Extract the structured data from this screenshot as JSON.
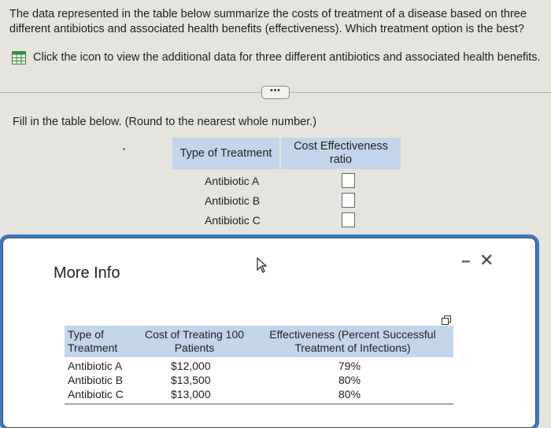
{
  "question": "The data represented in the table below summarize the costs of treatment of a disease based on three different antibiotics and associated health benefits (effectiveness). Which treatment option is the best?",
  "info_link": "Click the icon to view the additional data for three different antibiotics and associated health benefits.",
  "ellipsis": "•••",
  "instruction": "Fill in the table below. (Round to the nearest whole number.)",
  "answer_table": {
    "col1": "Type of Treatment",
    "col2_line1": "Cost Effectiveness",
    "col2_line2": "ratio",
    "rows": [
      "Antibiotic A",
      "Antibiotic B",
      "Antibiotic C"
    ]
  },
  "modal": {
    "title": "More Info",
    "minimize": "−",
    "close": "✕",
    "table": {
      "h1_line1": "Type of",
      "h1_line2": "Treatment",
      "h2_line1": "Cost of Treating 100",
      "h2_line2": "Patients",
      "h3_line1": "Effectiveness (Percent Successful",
      "h3_line2": "Treatment of Infections)",
      "rows": [
        {
          "type": "Antibiotic A",
          "cost": "$12,000",
          "eff": "79%"
        },
        {
          "type": "Antibiotic B",
          "cost": "$13,500",
          "eff": "80%"
        },
        {
          "type": "Antibiotic C",
          "cost": "$13,000",
          "eff": "80%"
        }
      ]
    }
  },
  "colors": {
    "header_blue": "#c2d5ea",
    "focus_ring": "#3b79c9",
    "icon_green": "#3a8a3e"
  }
}
